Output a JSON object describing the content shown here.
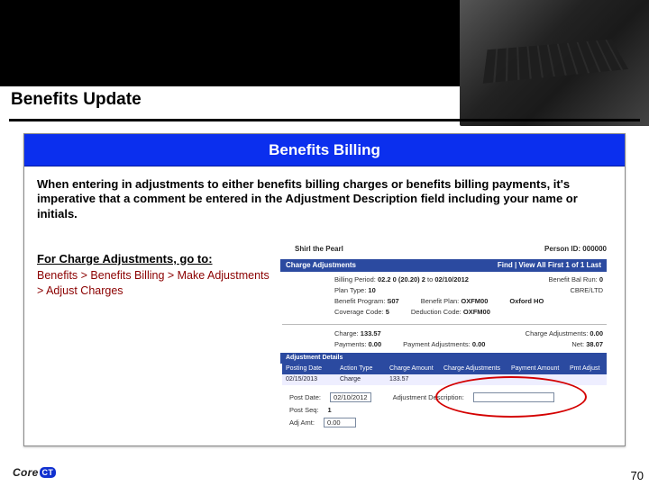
{
  "page": {
    "title": "Benefits Update",
    "section_heading": "Benefits Billing",
    "intro": "When entering in adjustments to either benefits billing charges or benefits billing payments, it's imperative that a comment be entered in the Adjustment Description field including your name or initials.",
    "subhead": "For Charge Adjustments, go to:",
    "nav_path": "Benefits > Benefits Billing > Make Adjustments > Adjust Charges",
    "page_number": "70",
    "logo": {
      "left": "Core",
      "right": "CT"
    }
  },
  "screenshot": {
    "tab": "Charge Adjustments",
    "employee_name": "Shirl the Pearl",
    "person_id_label": "Person ID:",
    "person_id": "000000",
    "bar1": {
      "left": "Charge Adjustments",
      "right_links": "Find | View All   First 1 of 1 Last"
    },
    "fields": {
      "billing_period": {
        "label": "Billing Period:",
        "value": "02.2  0 (20.20) 2",
        "sep": "to",
        "value2": "02/10/2012"
      },
      "benefit_bal": {
        "label": "Benefit Bal Run:",
        "value": "0"
      },
      "plan_type": {
        "label": "Plan Type:",
        "value": "10"
      },
      "cbre": {
        "label": "CBRE/LTD",
        "value": ""
      },
      "benefit_program": {
        "label": "Benefit Program:",
        "value": "S07"
      },
      "benefit_plan": {
        "label": "Benefit Plan:",
        "value": "OXFM00"
      },
      "plan2": {
        "label": "",
        "value": "Oxford HO"
      },
      "coverage_code": {
        "label": "Coverage Code:",
        "value": "5"
      },
      "deduction_code": {
        "label": "Deduction Code:",
        "value": "OXFM00"
      },
      "charge": {
        "label": "Charge:",
        "value": "133.57"
      },
      "charge_adjustments": {
        "label": "Charge Adjustments:",
        "value": "0.00"
      },
      "payments": {
        "label": "Payments:",
        "value": "0.00"
      },
      "payment_adjustments": {
        "label": "Payment Adjustments:",
        "value": "0.00"
      },
      "net": {
        "label": "Net:",
        "value": "38.07"
      }
    },
    "bar2": "Adjustment Details",
    "table": {
      "headers": [
        "Posting Date",
        "Action Type",
        "Charge Amount",
        "Charge Adjustments",
        "Payment Amount",
        "Pmt Adjust"
      ],
      "row": [
        "02/15/2013",
        "Charge",
        "133.57",
        "",
        "",
        ""
      ]
    },
    "bottom": {
      "post_date": {
        "label": "Post Date:",
        "value": "02/10/2012"
      },
      "adj_desc": {
        "label": "Adjustment Description:",
        "value": ""
      },
      "post_seq": {
        "label": "Post Seq:",
        "value": "1"
      },
      "adj_amt": {
        "label": "Adj Amt:",
        "value": "0.00"
      }
    }
  }
}
